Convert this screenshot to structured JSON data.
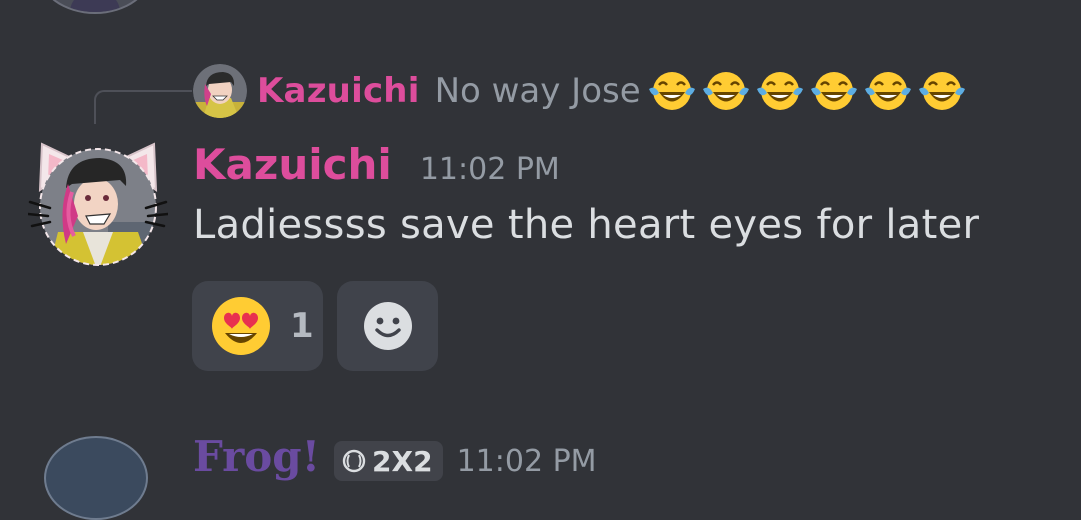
{
  "reply": {
    "author": "Kazuichi",
    "text": "No way Jose",
    "emoji_icon": "face-with-tears-of-joy-icon",
    "emoji_count_shown": 6
  },
  "message": {
    "author": "Kazuichi",
    "timestamp": "11:02 PM",
    "body": "Ladiessss save the heart eyes for later"
  },
  "reactions": {
    "heart_eyes": {
      "icon": "smiling-face-with-heart-eyes-icon",
      "count": "1"
    },
    "add_reaction_icon": "add-reaction-smiley-icon"
  },
  "next_message": {
    "author": "Frog!",
    "tag": "2X2",
    "timestamp": "11:02 PM"
  },
  "colors": {
    "background": "#313338",
    "author_pink": "#dd4d9c",
    "muted": "#949ba4",
    "body_text": "#dbdee1",
    "reaction_bg": "#40434b"
  }
}
